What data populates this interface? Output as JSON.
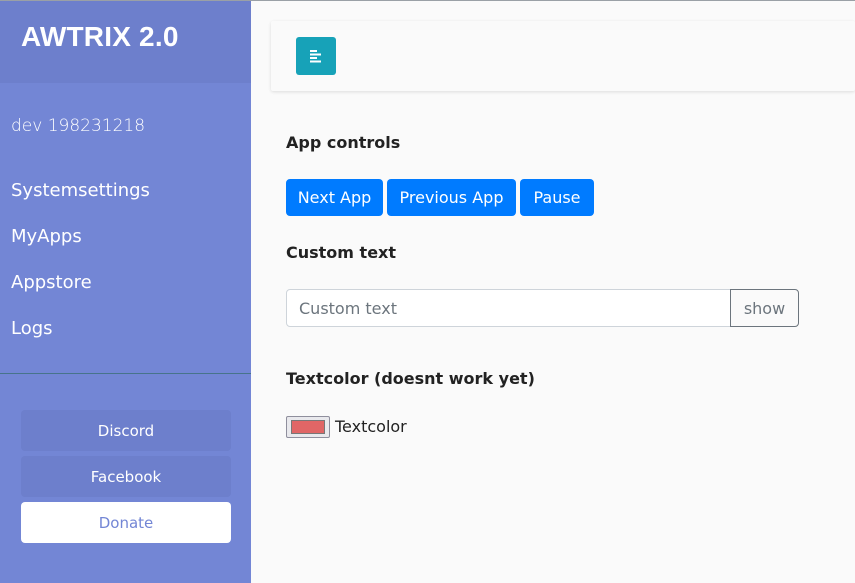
{
  "sidebar": {
    "brand": "AWTRIX 2.0",
    "device": "dev 198231218",
    "items": [
      {
        "label": "Systemsettings"
      },
      {
        "label": "MyApps"
      },
      {
        "label": "Appstore"
      },
      {
        "label": "Logs"
      }
    ],
    "buttons": {
      "discord": "Discord",
      "facebook": "Facebook",
      "donate": "Donate"
    }
  },
  "topbar": {
    "toggle_icon": "align-left-icon"
  },
  "app_controls": {
    "title": "App controls",
    "next": "Next App",
    "previous": "Previous App",
    "pause": "Pause"
  },
  "custom_text": {
    "title": "Custom text",
    "placeholder": "Custom text",
    "value": "",
    "show": "show"
  },
  "textcolor": {
    "title": "Textcolor (doesnt work yet)",
    "label": "Textcolor",
    "value": "#e06666"
  },
  "colors": {
    "sidebar": "#7386d5",
    "sidebar_header": "#6d7fcc",
    "primary": "#007bff",
    "info": "#17a2b8"
  }
}
